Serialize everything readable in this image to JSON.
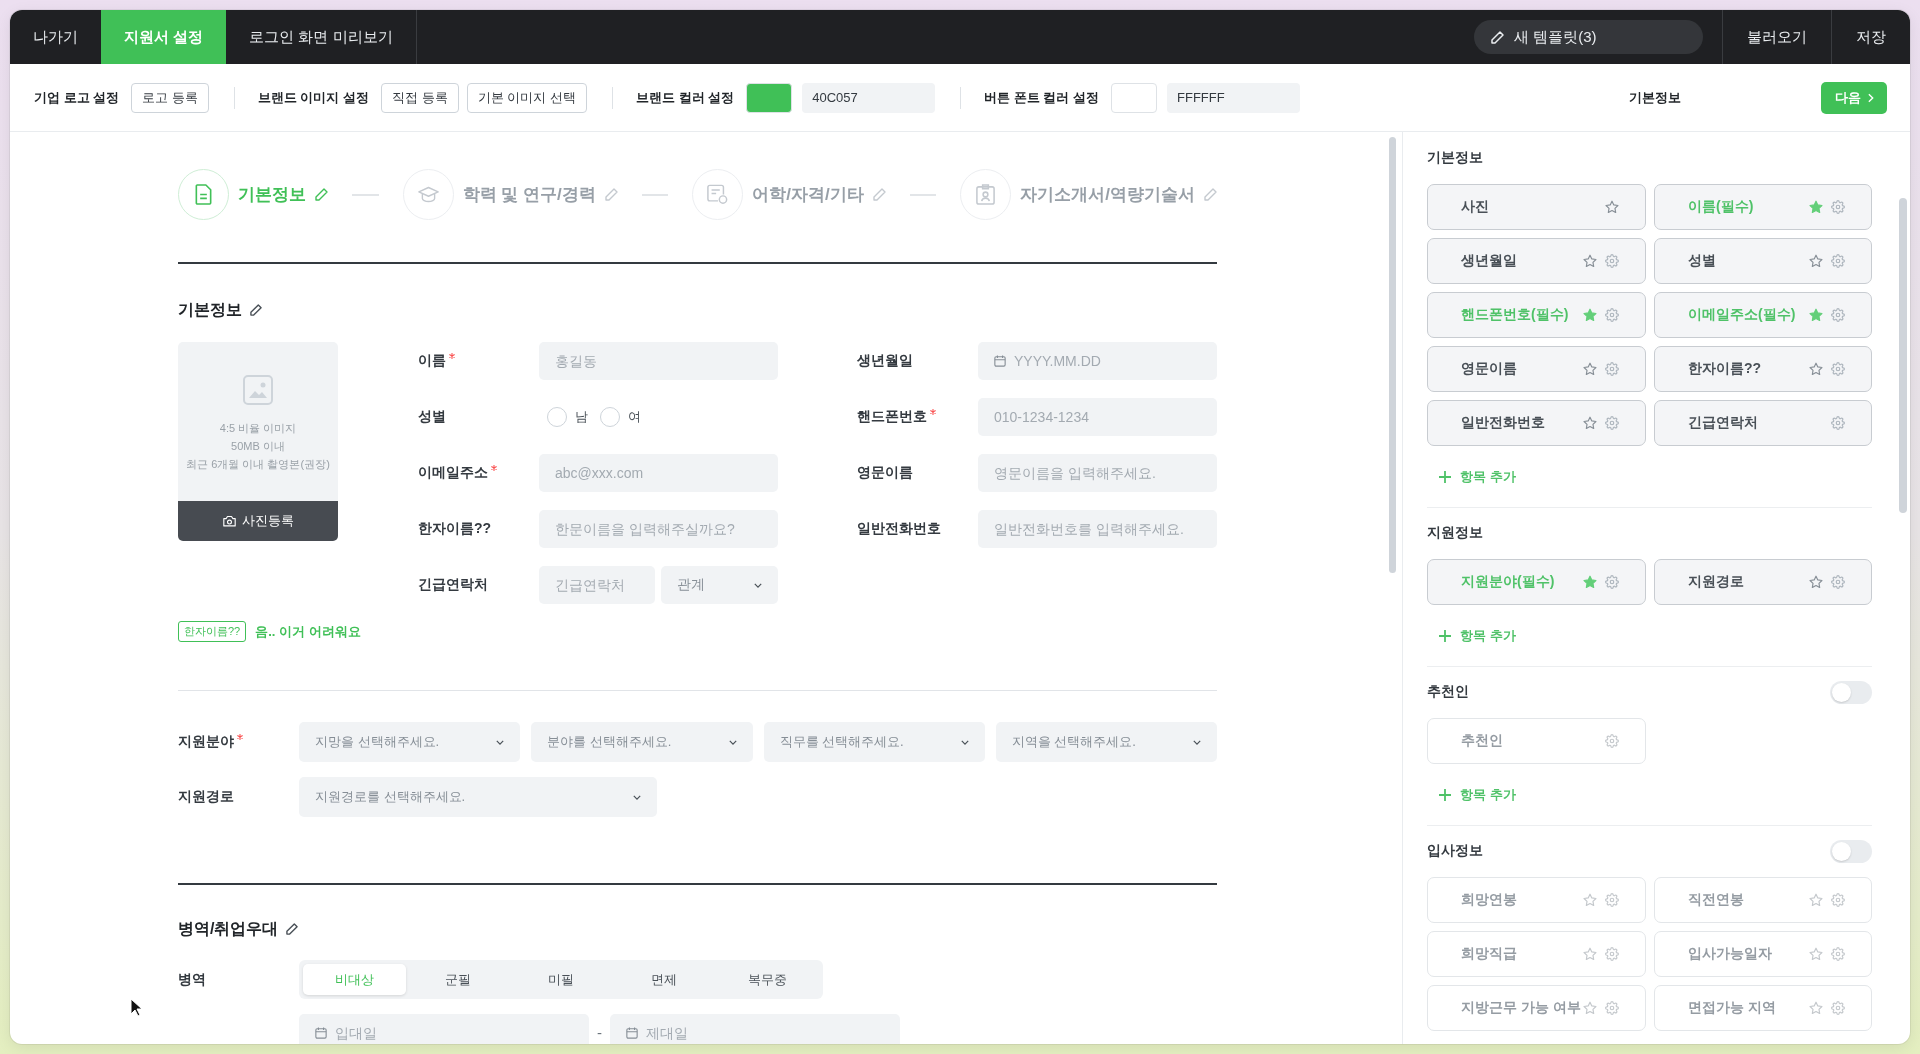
{
  "nav": {
    "tabs": [
      {
        "label": "나가기",
        "selected": false
      },
      {
        "label": "지원서 설정",
        "selected": true
      },
      {
        "label": "로그인 화면 미리보기",
        "selected": false
      }
    ],
    "template_button": "새 템플릿(3)",
    "actions": [
      "불러오기",
      "저장"
    ]
  },
  "toolbar": {
    "groups": [
      {
        "kind": "buttons",
        "label": "기업 로고 설정",
        "buttons": [
          "로고 등록"
        ]
      },
      {
        "kind": "buttons",
        "label": "브랜드 이미지 설정",
        "buttons": [
          "직접 등록",
          "기본 이미지 선택"
        ]
      },
      {
        "kind": "color",
        "label": "브랜드 컬러 설정",
        "color": "#40c057",
        "value": "40C057"
      },
      {
        "kind": "color",
        "label": "버튼 폰트 컬러 설정",
        "color": "#ffffff",
        "value": "FFFFFF"
      }
    ],
    "current_section": "기본정보",
    "next_button": "다음"
  },
  "steps": [
    {
      "kind": "document",
      "label": "기본정보",
      "selected": true
    },
    {
      "kind": "education",
      "label": "학력 및 연구/경력",
      "selected": false
    },
    {
      "kind": "certificate",
      "label": "어학/자격/기타",
      "selected": false
    },
    {
      "kind": "profile",
      "label": "자기소개서/역량기술서",
      "selected": false
    }
  ],
  "basic_info": {
    "title": "기본정보",
    "photo": {
      "hints": [
        "4:5 비율 이미지",
        "50MB 이내",
        "최근 6개월 이내 촬영본(권장)"
      ],
      "button": "사진등록"
    },
    "fields": [
      {
        "kind": "text",
        "label": "이름",
        "required": true,
        "placeholder": "홍길동"
      },
      {
        "kind": "date",
        "label": "생년월일",
        "required": false,
        "placeholder": "YYYY.MM.DD"
      },
      {
        "kind": "radio",
        "label": "성별",
        "required": false,
        "options": [
          {
            "label": "남",
            "selected": false
          },
          {
            "label": "여",
            "selected": false
          }
        ]
      },
      {
        "kind": "text",
        "label": "핸드폰번호",
        "required": true,
        "placeholder": "010-1234-1234"
      },
      {
        "kind": "text",
        "label": "이메일주소",
        "required": true,
        "placeholder": "abc@xxx.com"
      },
      {
        "kind": "text",
        "label": "영문이름",
        "required": false,
        "placeholder": "영문이름을 입력해주세요."
      },
      {
        "kind": "text",
        "label": "한자이름??",
        "required": false,
        "placeholder": "한문이름을 입력해주실까요?"
      },
      {
        "kind": "text",
        "label": "일반전화번호",
        "required": false,
        "placeholder": "일반전화번호를 입력해주세요."
      },
      {
        "kind": "contact",
        "label": "긴급연락처",
        "required": false,
        "placeholder": "긴급연락처",
        "select": "관계"
      }
    ],
    "note": {
      "tag": "한자이름??",
      "text": "음.. 이거 어려워요"
    }
  },
  "application": {
    "rows": [
      {
        "label": "지원분야",
        "required": true,
        "select_placeholders": [
          "지망을 선택해주세요.",
          "분야를 선택해주세요.",
          "직무를 선택해주세요.",
          "지역을 선택해주세요."
        ]
      },
      {
        "label": "지원경로",
        "required": false,
        "select_placeholders": [
          "지원경로를 선택해주세요."
        ]
      }
    ]
  },
  "military": {
    "title": "병역/취업우대",
    "label": "병역",
    "options": [
      {
        "label": "비대상",
        "selected": true
      },
      {
        "label": "군필",
        "selected": false
      },
      {
        "label": "미필",
        "selected": false
      },
      {
        "label": "면제",
        "selected": false
      },
      {
        "label": "복무중",
        "selected": false
      }
    ],
    "dates": {
      "start_placeholder": "입대일",
      "separator": "-",
      "end_placeholder": "제대일"
    }
  },
  "panel": {
    "sections": [
      {
        "title": "기본정보",
        "items": [
          {
            "label": "사진",
            "required": false,
            "star": true,
            "settings": false
          },
          {
            "label": "이름(필수)",
            "required": true,
            "star": true,
            "settings": true
          },
          {
            "label": "생년월일",
            "required": false,
            "star": true,
            "settings": true
          },
          {
            "label": "성별",
            "required": false,
            "star": true,
            "settings": true
          },
          {
            "label": "핸드폰번호(필수)",
            "required": true,
            "star": true,
            "settings": true
          },
          {
            "label": "이메일주소(필수)",
            "required": true,
            "star": true,
            "settings": true
          },
          {
            "label": "영문이름",
            "required": false,
            "star": true,
            "settings": true
          },
          {
            "label": "한자이름??",
            "required": false,
            "star": true,
            "settings": true
          },
          {
            "label": "일반전화번호",
            "required": false,
            "star": true,
            "settings": true
          },
          {
            "label": "긴급연락처",
            "required": false,
            "star": false,
            "settings": true
          }
        ],
        "add_label": "항목 추가"
      },
      {
        "title": "지원정보",
        "items": [
          {
            "label": "지원분야(필수)",
            "required": true,
            "star": true,
            "settings": true
          },
          {
            "label": "지원경로",
            "required": false,
            "star": true,
            "settings": true
          }
        ],
        "add_label": "항목 추가"
      },
      {
        "title": "추천인",
        "toggle": {
          "on": false
        },
        "items": [
          {
            "label": "추천인",
            "required": false,
            "star": false,
            "settings": true
          }
        ],
        "add_label": "항목 추가"
      },
      {
        "title": "입사정보",
        "toggle": {
          "on": false
        },
        "items": [
          {
            "label": "희망연봉",
            "required": false,
            "star": true,
            "settings": true
          },
          {
            "label": "직전연봉",
            "required": false,
            "star": true,
            "settings": true
          },
          {
            "label": "희망직급",
            "required": false,
            "star": true,
            "settings": true
          },
          {
            "label": "입사가능일자",
            "required": false,
            "star": true,
            "settings": true
          },
          {
            "label": "지방근무 가능 여부",
            "required": false,
            "star": true,
            "settings": true
          },
          {
            "label": "면접가능 지역",
            "required": false,
            "star": true,
            "settings": true
          }
        ]
      }
    ]
  }
}
